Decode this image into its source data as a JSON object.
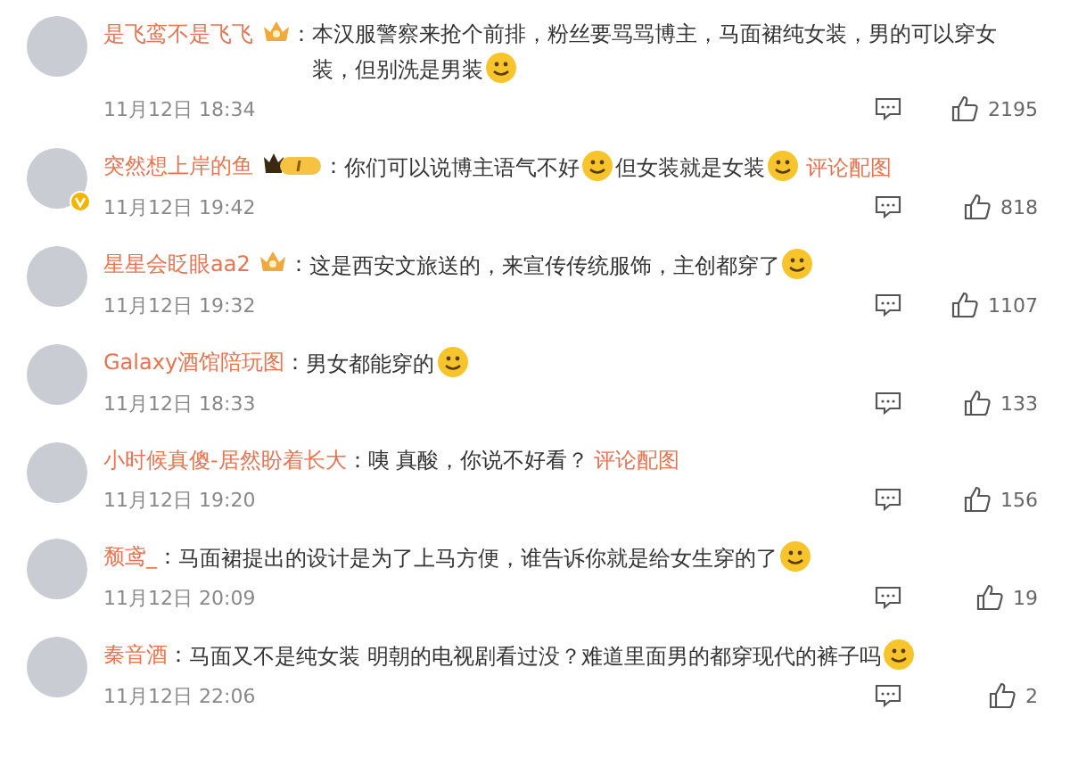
{
  "comments": [
    {
      "author": "是飞鸾不是飞飞",
      "badge": {
        "kind": "crown"
      },
      "verified": false,
      "separator": "：",
      "body": [
        {
          "kind": "text",
          "text": "本汉服警察来抢个前排，粉丝要骂骂博主，马面裙纯女装，男的可以穿女装，但别洗是男装"
        },
        {
          "kind": "emoji"
        }
      ],
      "time": "11月12日 18:34",
      "likes": "2195"
    },
    {
      "author": "突然想上岸的鱼",
      "badge": {
        "kind": "level"
      },
      "verified": true,
      "separator": "：",
      "body": [
        {
          "kind": "text",
          "text": "你们可以说博主语气不好"
        },
        {
          "kind": "emoji"
        },
        {
          "kind": "text",
          "text": "但女装就是女装"
        },
        {
          "kind": "emoji"
        },
        {
          "kind": "link",
          "text": "评论配图"
        }
      ],
      "time": "11月12日 19:42",
      "likes": "818"
    },
    {
      "author": "星星会眨眼aa2",
      "badge": {
        "kind": "crown"
      },
      "verified": false,
      "separator": "：",
      "body": [
        {
          "kind": "text",
          "text": "这是西安文旅送的，来宣传传统服饰，主创都穿了"
        },
        {
          "kind": "emoji"
        }
      ],
      "time": "11月12日 19:32",
      "likes": "1107"
    },
    {
      "author": "Galaxy酒馆陪玩图",
      "verified": false,
      "separator": "：",
      "body": [
        {
          "kind": "text",
          "text": "男女都能穿的"
        },
        {
          "kind": "emoji"
        }
      ],
      "time": "11月12日 18:33",
      "likes": "133"
    },
    {
      "author": "小时候真傻-居然盼着长大",
      "verified": false,
      "separator": "：",
      "body": [
        {
          "kind": "text",
          "text": "咦 真酸，你说不好看？"
        },
        {
          "kind": "link",
          "text": "评论配图"
        }
      ],
      "time": "11月12日 19:20",
      "likes": "156"
    },
    {
      "author": "颓鸢_",
      "verified": false,
      "separator": "：",
      "body": [
        {
          "kind": "text",
          "text": "马面裙提出的设计是为了上马方便，谁告诉你就是给女生穿的了"
        },
        {
          "kind": "emoji"
        }
      ],
      "time": "11月12日 20:09",
      "likes": "19"
    },
    {
      "author": "秦音酒",
      "verified": false,
      "separator": "：",
      "body": [
        {
          "kind": "text",
          "text": "马面又不是纯女装 明朝的电视剧看过没？难道里面男的都穿现代的裤子吗"
        },
        {
          "kind": "emoji"
        }
      ],
      "time": "11月12日 22:06",
      "likes": "2"
    }
  ]
}
